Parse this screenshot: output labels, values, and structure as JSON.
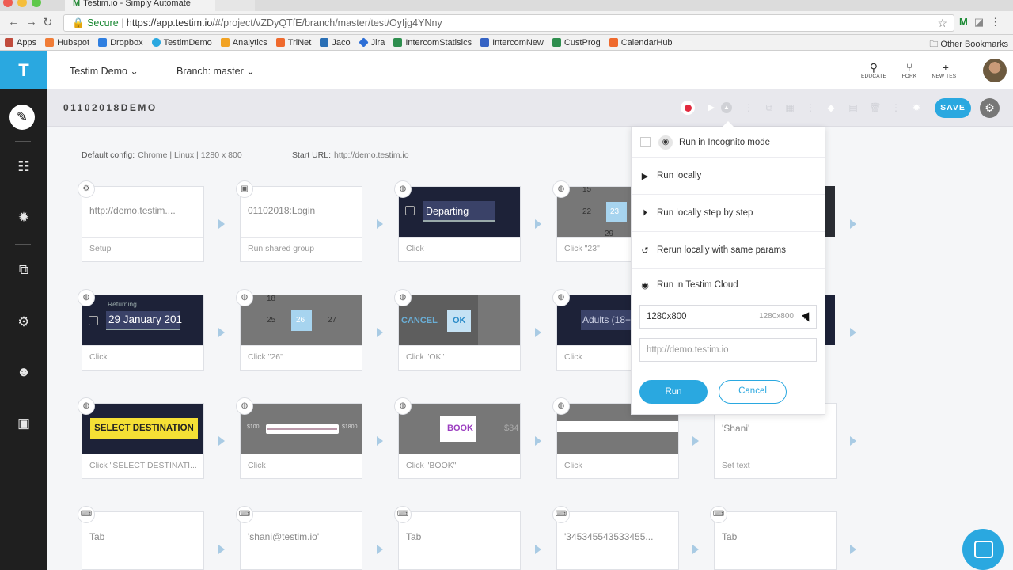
{
  "browser": {
    "tab_title": "Testim.io - Simply Automate",
    "secure_label": "Secure",
    "url_domain": "https://app.testim.io",
    "url_path": "/#/project/vZDyQTfE/branch/master/test/OyIjg4YNny",
    "bookmarks": [
      {
        "label": "Apps",
        "color": "#c04b3c"
      },
      {
        "label": "Hubspot",
        "color": "#f07c36"
      },
      {
        "label": "Dropbox",
        "color": "#2f7fe0"
      },
      {
        "label": "TestimDemo",
        "color": "#2aa8e0"
      },
      {
        "label": "Analytics",
        "color": "#f2a324"
      },
      {
        "label": "TriNet",
        "color": "#ef6a2d"
      },
      {
        "label": "Jaco",
        "color": "#2a6fb5"
      },
      {
        "label": "Jira",
        "color": "#2d6fd6"
      },
      {
        "label": "IntercomStatisics",
        "color": "#2e8e4e"
      },
      {
        "label": "IntercomNew",
        "color": "#3563c4"
      },
      {
        "label": "CustProg",
        "color": "#2e8e4e"
      },
      {
        "label": "CalendarHub",
        "color": "#ef6a2d"
      }
    ],
    "other_bookmarks": "Other Bookmarks"
  },
  "app": {
    "logo": "T",
    "project": "Testim Demo",
    "branch": "Branch: master",
    "actions": [
      {
        "label": "EDUCATE",
        "glyph": "⚲"
      },
      {
        "label": "FORK",
        "glyph": "⑂"
      },
      {
        "label": "NEW TEST",
        "glyph": "+"
      }
    ]
  },
  "toolbar": {
    "test_name": "01102018DEMO",
    "save_label": "SAVE"
  },
  "config": {
    "default_label": "Default config:",
    "default_value": "Chrome | Linux | 1280 x 800",
    "start_label": "Start URL:",
    "start_value": "http://demo.testim.io"
  },
  "steps": {
    "r1": [
      {
        "text": "http://demo.testim....",
        "caption": "Setup"
      },
      {
        "text": "01102018:Login",
        "caption": "Run shared group"
      },
      {
        "shot": "Departing",
        "caption": "Click"
      },
      {
        "shot_top": "15",
        "shot_a": "22",
        "shot_b": "23",
        "shot_bottom": "29",
        "caption": "Click \"23\""
      }
    ],
    "r2": [
      {
        "shot_small": "Returning",
        "shot": "29 January 201",
        "caption": "Click"
      },
      {
        "shot_top": "18",
        "shot_a": "25",
        "shot_b": "26",
        "shot_c": "27",
        "caption": "Click \"26\""
      },
      {
        "shot_a": "CANCEL",
        "shot_b": "OK",
        "caption": "Click \"OK\""
      },
      {
        "shot": "Adults (18+",
        "caption": "Click"
      }
    ],
    "r3": [
      {
        "shot": "SELECT DESTINATION",
        "caption": "Click \"SELECT DESTINATI..."
      },
      {
        "shot_a": "$100",
        "shot_b": "$1800",
        "caption": "Click"
      },
      {
        "shot": "BOOK",
        "shot_b": "$34",
        "caption": "Click \"BOOK\""
      },
      {
        "caption": "Click"
      },
      {
        "text": "'Shani'",
        "caption": "Set text"
      }
    ],
    "r4": [
      {
        "text": "Tab"
      },
      {
        "text": "'shani@testim.io'"
      },
      {
        "text": "Tab"
      },
      {
        "text": "'345345543533455..."
      },
      {
        "text": "Tab"
      }
    ]
  },
  "run_menu": {
    "incognito": "Run in Incognito mode",
    "run_locally": "Run locally",
    "step_by_step": "Run locally step by step",
    "rerun": "Rerun locally with same params",
    "cloud": "Run in Testim Cloud",
    "resolution_value": "1280x800",
    "resolution_hint": "1280x800",
    "url_placeholder": "http://demo.testim.io",
    "run_label": "Run",
    "cancel_label": "Cancel"
  },
  "colors": {
    "accent": "#2aa8e0",
    "record": "#e2293e",
    "sidebar": "#1f1f1f"
  }
}
